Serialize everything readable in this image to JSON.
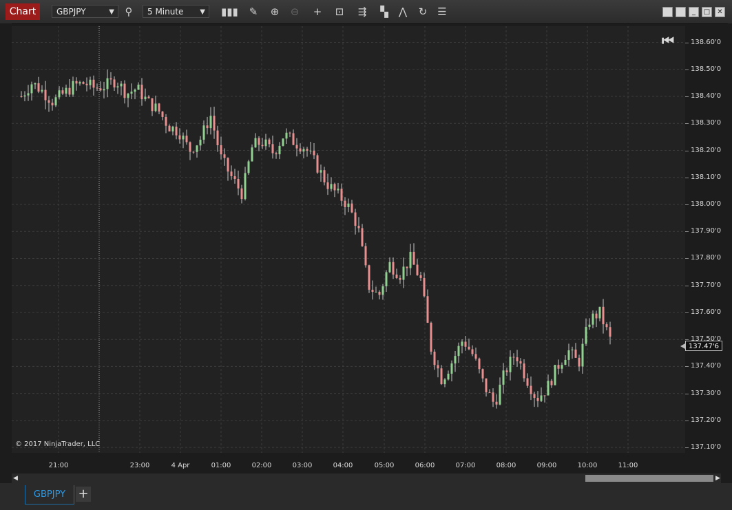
{
  "toolbar": {
    "chart_tab_label": "Chart",
    "instrument": "GBPJPY",
    "interval": "5 Minute",
    "icons": [
      "search-icon",
      "bar-type-icon",
      "pencil-icon",
      "zoom-in-icon",
      "zoom-out-icon",
      "crosshair-icon",
      "data-box-icon",
      "properties-icon",
      "strategies-icon",
      "drawing-tools-icon",
      "reload-icon",
      "list-icon"
    ]
  },
  "window": {
    "buttons": [
      "tile-icon",
      "tile-icon",
      "minimize-icon",
      "maximize-icon",
      "close-icon"
    ]
  },
  "chart": {
    "copyright": "© 2017 NinjaTrader, LLC",
    "current_price": "137.47'6",
    "price_labels": [
      "138.60'0",
      "138.50'0",
      "138.40'0",
      "138.30'0",
      "138.20'0",
      "138.10'0",
      "138.00'0",
      "137.90'0",
      "137.80'0",
      "137.70'0",
      "137.60'0",
      "137.50'0",
      "137.40'0",
      "137.30'0",
      "137.20'0",
      "137.10'0"
    ],
    "time_labels": [
      "21:00",
      "23:00",
      "4 Apr",
      "01:00",
      "02:00",
      "03:00",
      "04:00",
      "05:00",
      "06:00",
      "07:00",
      "08:00",
      "09:00",
      "10:00",
      "11:00"
    ],
    "colors": {
      "up": "#90d090",
      "down": "#e89090",
      "wick": "#c8c8c8",
      "grid": "#3c3c3c",
      "background": "#222222"
    }
  },
  "chart_data": {
    "type": "candlestick",
    "instrument": "GBPJPY",
    "interval": "5 Minute",
    "ylim": [
      137.08,
      138.66
    ],
    "close_path": [
      138.4,
      138.45,
      138.42,
      138.38,
      138.41,
      138.44,
      138.45,
      138.43,
      138.44,
      138.46,
      138.41,
      138.43,
      138.38,
      138.35,
      138.29,
      138.27,
      138.2,
      138.24,
      138.33,
      138.17,
      138.1,
      138.04,
      138.22,
      138.23,
      138.19,
      138.26,
      138.23,
      138.21,
      138.15,
      138.08,
      138.04,
      138.0,
      137.92,
      137.7,
      137.66,
      137.78,
      137.74,
      137.8,
      137.72,
      137.46,
      137.35,
      137.42,
      137.5,
      137.44,
      137.33,
      137.26,
      137.38,
      137.45,
      137.36,
      137.28,
      137.32,
      137.4,
      137.46,
      137.41,
      137.57,
      137.6,
      137.5
    ],
    "price_range_visible": [
      "137.21",
      "138.51"
    ]
  },
  "bottom": {
    "tab_label": "GBPJPY",
    "add_label": "+"
  }
}
